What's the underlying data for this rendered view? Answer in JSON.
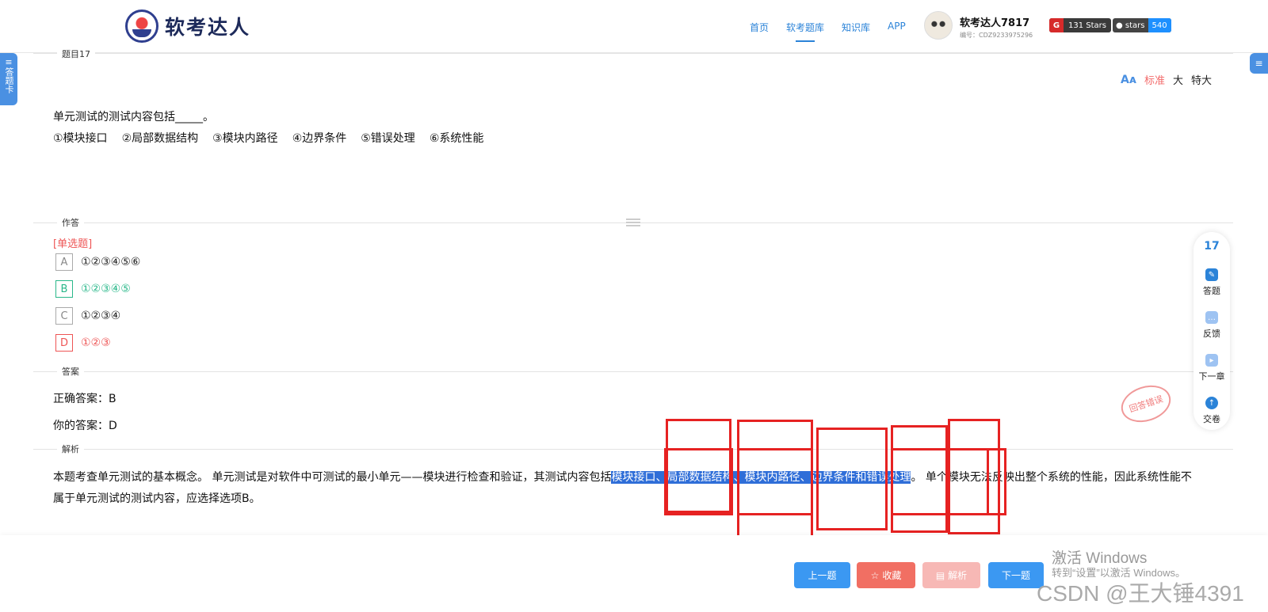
{
  "site": {
    "logo_text": "软考达人"
  },
  "nav": [
    "首页",
    "软考题库",
    "知识库",
    "APP"
  ],
  "user": {
    "name": "软考达人7817",
    "id": "编号：CDZ9233975296"
  },
  "badges": {
    "gitee_stars": "131 Stars",
    "github_label": "stars",
    "github_count": "540"
  },
  "side": {
    "left_tab": "答题卡"
  },
  "question": {
    "section_label": "题目17",
    "font_sizes": [
      "标准",
      "大",
      "特大"
    ],
    "stem": "单元测试的测试内容包括_____。",
    "items": [
      "①模块接口",
      "②局部数据结构",
      "③模块内路径",
      "④边界条件",
      "⑤错误处理",
      "⑥系统性能"
    ]
  },
  "answer_area": {
    "section_label": "作答",
    "type": "[单选题]",
    "options": [
      {
        "letter": "A",
        "text": "①②③④⑤⑥"
      },
      {
        "letter": "B",
        "text": "①②③④⑤"
      },
      {
        "letter": "C",
        "text": "①②③④"
      },
      {
        "letter": "D",
        "text": "①②③"
      }
    ]
  },
  "result": {
    "section_label": "答案",
    "correct": "正确答案：B",
    "yours": "你的答案：D",
    "stamp": "回答错误"
  },
  "analysis": {
    "section_label": "解析",
    "text_before": "本题考查单元测试的基本概念。    单元测试是对软件中可测试的最小单元——模块进行检查和验证，其测试内容包括",
    "highlighted": "模块接口、局部数据结构、模块内路径、边界条件和错误处理",
    "text_after": "。    单个模块无法反映出整个系统的性能，因此系统性能不属于单元测试的测试内容，应选择选项B。"
  },
  "right_panel": {
    "number": "17",
    "items": [
      "答题",
      "反馈",
      "下一章",
      "交卷"
    ]
  },
  "footer": {
    "prev": "上一题",
    "favorite": "收藏",
    "analysis": "解析",
    "next": "下一题"
  },
  "watermarks": {
    "win_title": "激活 Windows",
    "win_sub": "转到“设置”以激活 Windows。",
    "csdn": "CSDN @王大锤4391"
  },
  "colors": {
    "accent": "#2b83d8",
    "correct": "#2ab88a",
    "wrong": "#e55555",
    "highlight": "#2f6ed8",
    "annotation": "#e62222"
  }
}
